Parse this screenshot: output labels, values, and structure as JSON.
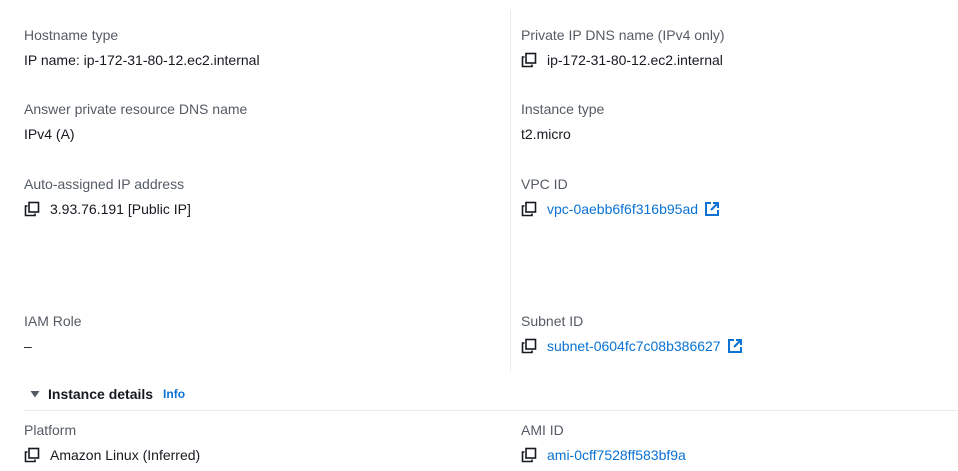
{
  "fields": {
    "hostname_type": {
      "label": "Hostname type",
      "value": "IP name: ip-172-31-80-12.ec2.internal"
    },
    "private_ip_dns": {
      "label": "Private IP DNS name (IPv4 only)",
      "value": "ip-172-31-80-12.ec2.internal"
    },
    "answer_private_dns": {
      "label": "Answer private resource DNS name",
      "value": "IPv4 (A)"
    },
    "instance_type": {
      "label": "Instance type",
      "value": "t2.micro"
    },
    "auto_ip": {
      "label": "Auto-assigned IP address",
      "value": "3.93.76.191 [Public IP]"
    },
    "vpc_id": {
      "label": "VPC ID",
      "value": "vpc-0aebb6f6f316b95ad"
    },
    "iam_role": {
      "label": "IAM Role",
      "value": "–"
    },
    "subnet_id": {
      "label": "Subnet ID",
      "value": "subnet-0604fc7c08b386627"
    },
    "platform": {
      "label": "Platform",
      "value": "Amazon Linux (Inferred)"
    },
    "ami_id": {
      "label": "AMI ID",
      "value": "ami-0cff7528ff583bf9a"
    }
  },
  "section": {
    "title": "Instance details",
    "info": "Info"
  },
  "colors": {
    "link": "#0972d3",
    "label": "#545b64",
    "text": "#16191f"
  },
  "icons": {
    "copy": "copy-icon",
    "external": "external-link-icon",
    "caret": "caret-down-icon"
  }
}
